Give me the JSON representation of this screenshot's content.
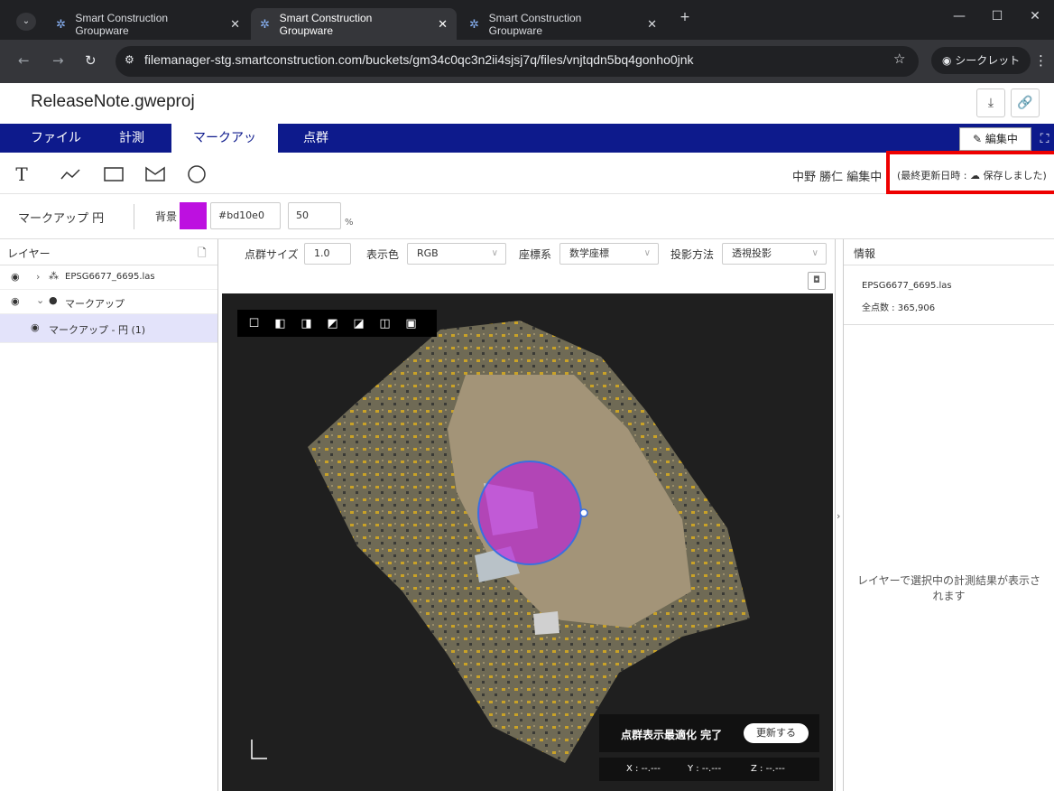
{
  "browser": {
    "tabs": [
      {
        "label": "Smart Construction Groupware",
        "active": false
      },
      {
        "label": "Smart Construction Groupware",
        "active": true
      },
      {
        "label": "Smart Construction Groupware",
        "active": false
      }
    ],
    "url": "filemanager-stg.smartconstruction.com/buckets/gm34c0qc3n2ii4sjsj7q/files/vnjtqdn5bq4gonho0jnk",
    "incognito_label": "シークレット"
  },
  "app": {
    "file_name": "ReleaseNote.gweproj",
    "menu_tabs": [
      "ファイル",
      "計測",
      "マークアップ",
      "点群"
    ],
    "edit_button": "編集中",
    "editor_status": "中野 勝仁 編集中",
    "save_status": "(最終更新日時 : ☁ 保存しました)"
  },
  "markup_props": {
    "title": "マークアップ 円",
    "bg_label": "背景",
    "color": "#bd10e0",
    "color_hex_text": "#bd10e0",
    "opacity": "50",
    "opacity_unit": "%"
  },
  "layers": {
    "header": "レイヤー",
    "items": [
      {
        "label": "EPSG6677_6695.las"
      },
      {
        "label": "マークアップ"
      },
      {
        "label": "マークアップ - 円 (1)"
      }
    ]
  },
  "viewer_settings": {
    "point_size_label": "点群サイズ",
    "point_size": "1.0",
    "color_label": "表示色",
    "color_value": "RGB",
    "coord_label": "座標系",
    "coord_value": "数学座標",
    "proj_label": "投影方法",
    "proj_value": "透視投影"
  },
  "viewer": {
    "optimize_text": "点群表示最適化 完了",
    "update_button": "更新する",
    "coords": {
      "x": "X : --.---",
      "y": "Y : --.---",
      "z": "Z : --.---"
    }
  },
  "info": {
    "header": "情報",
    "file": "EPSG6677_6695.las",
    "point_count": "全点数 : 365,906",
    "message": "レイヤーで選択中の計測結果が表示されます"
  }
}
